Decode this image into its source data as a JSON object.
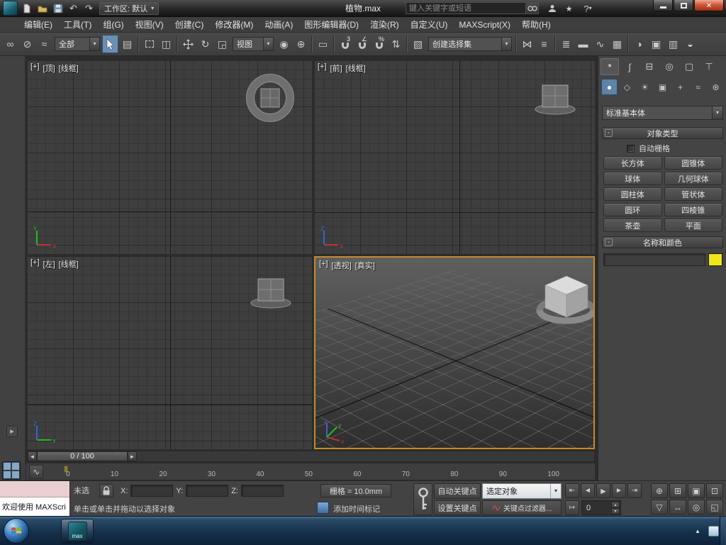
{
  "colors": {
    "active_viewport_border": "#c98a2b",
    "object_color": "#f0e618"
  },
  "titlebar": {
    "workspace": "工作区: 默认",
    "filename": "植物.max",
    "search_placeholder": "键入关键字或短语"
  },
  "menus": [
    "编辑(E)",
    "工具(T)",
    "组(G)",
    "视图(V)",
    "创建(C)",
    "修改器(M)",
    "动画(A)",
    "图形编辑器(D)",
    "渲染(R)",
    "自定义(U)",
    "MAXScript(X)",
    "帮助(H)"
  ],
  "toolbar": {
    "selection_filter": "全部",
    "reference_coord": "视图",
    "named_sets": "创建选择集"
  },
  "viewports": {
    "top": {
      "plus": "[+]",
      "name": "[顶]",
      "shading": "[线框]"
    },
    "front": {
      "plus": "[+]",
      "name": "[前]",
      "shading": "[线框]"
    },
    "left": {
      "plus": "[+]",
      "name": "[左]",
      "shading": "[线框]"
    },
    "persp": {
      "plus": "[+]",
      "name": "[透视]",
      "shading": "[真实]"
    }
  },
  "timeline": {
    "slider": "0 / 100",
    "ticks": [
      "0",
      "10",
      "20",
      "30",
      "40",
      "50",
      "60",
      "70",
      "80",
      "90",
      "100"
    ]
  },
  "command_panel": {
    "dropdown": "标准基本体",
    "object_type_rollout": "对象类型",
    "autogrid": "自动栅格",
    "primitives": [
      "长方体",
      "圆锥体",
      "球体",
      "几何球体",
      "圆柱体",
      "管状体",
      "圆环",
      "四棱锥",
      "茶壶",
      "平面"
    ],
    "name_color_rollout": "名称和颜色"
  },
  "statusbar": {
    "listener": "欢迎使用 MAXScri",
    "status": "未选",
    "x": "X:",
    "y": "Y:",
    "z": "Z:",
    "grid": "栅格 = 10.0mm",
    "prompt": "单击或单击并拖动以选择对象",
    "time_tag": "添加时间标记",
    "auto_key": "自动关键点",
    "set_key": "设置关键点",
    "key_dropdown": "选定对象",
    "key_filters": "关键点过滤器...",
    "frame": "0"
  },
  "taskbar": {
    "app_label": "max"
  },
  "icons": {
    "undo": "↶",
    "redo": "↷",
    "dropdown_arrow": "▾",
    "star": "★",
    "help": "?",
    "close": "×",
    "link": "∞",
    "unlink": "⊘",
    "bind": "≈",
    "select_by_name": "▤",
    "window_crossing": "◫",
    "rotate": "↻",
    "scale": "◲",
    "pivot": "◉",
    "manipulate": "⊕",
    "keyboard": "▭",
    "snap3": "3",
    "angle": "∠",
    "percent": "%",
    "spinner": "⇅",
    "edit_sets": "▧",
    "mirror": "⋈",
    "align": "≡",
    "layers": "≣",
    "ribbon": "▬",
    "curves": "∿",
    "schematic": "▦",
    "material": "◑",
    "render_setup": "▣",
    "rendered_frame": "▥",
    "render": "◒",
    "tab_create": "*",
    "tab_modify": "∫",
    "tab_hierarchy": "⊟",
    "tab_motion": "◎",
    "tab_display": "▢",
    "tab_utils": "⊤",
    "cat_geometry": "●",
    "cat_shapes": "◇",
    "cat_lights": "☀",
    "cat_cameras": "▣",
    "cat_helpers": "+",
    "cat_warps": "≈",
    "cat_systems": "⊛",
    "minus": "-",
    "ts_left": "◄",
    "ts_right": "►",
    "flyout": "▶",
    "go_start": "⇤",
    "prev_frame": "◄",
    "play": "►",
    "next_frame": "►",
    "go_end": "⇥",
    "key_mode": "↦",
    "zoom": "⊕",
    "zoom_all": "⊞",
    "extents": "▣",
    "extents_all": "⊡",
    "fov": "▽",
    "pan": "↔",
    "orbit": "◎",
    "vp_max": "◱",
    "spin_up": "▴",
    "spin_down": "▾",
    "tray_chevron": "▴",
    "curve_mini": "∿"
  }
}
